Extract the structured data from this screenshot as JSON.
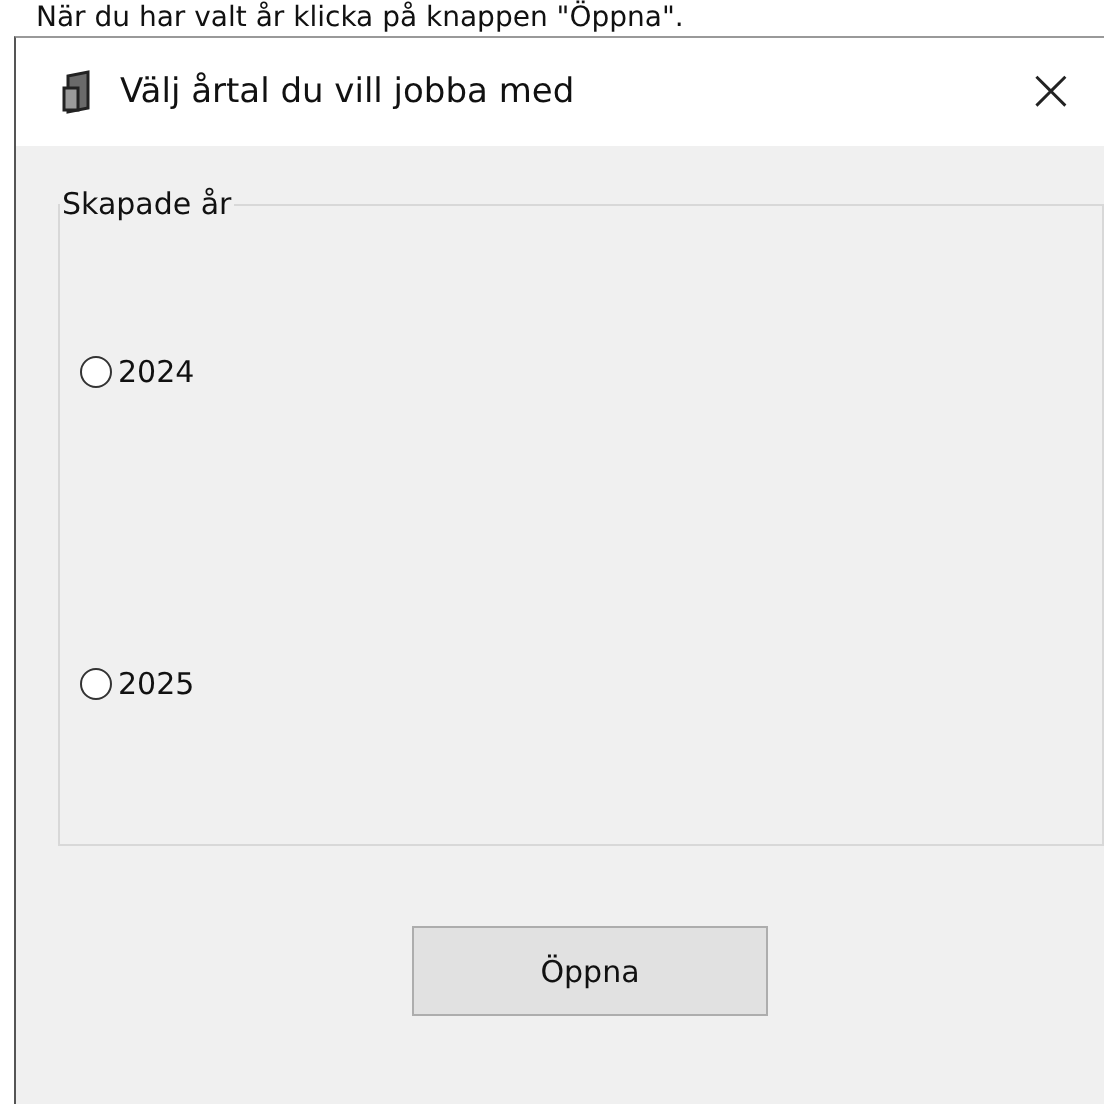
{
  "caption": "När du har valt år klicka på knappen \"Öppna\".",
  "window": {
    "title": "Välj årtal du vill jobba med",
    "close": "×"
  },
  "group": {
    "label": "Skapade år",
    "options": [
      {
        "label": "2024",
        "selected": false
      },
      {
        "label": "2025",
        "selected": false
      }
    ]
  },
  "buttons": [
    "Öppna"
  ]
}
